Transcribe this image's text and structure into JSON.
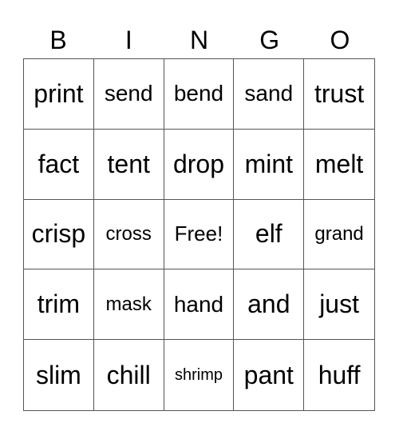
{
  "header": {
    "letters": [
      "B",
      "I",
      "N",
      "G",
      "O"
    ]
  },
  "grid": {
    "rows": [
      [
        "print",
        "send",
        "bend",
        "sand",
        "trust"
      ],
      [
        "fact",
        "tent",
        "drop",
        "mint",
        "melt"
      ],
      [
        "crisp",
        "cross",
        "Free!",
        "elf",
        "grand"
      ],
      [
        "trim",
        "mask",
        "hand",
        "and",
        "just"
      ],
      [
        "slim",
        "chill",
        "shrimp",
        "pant",
        "huff"
      ]
    ]
  }
}
